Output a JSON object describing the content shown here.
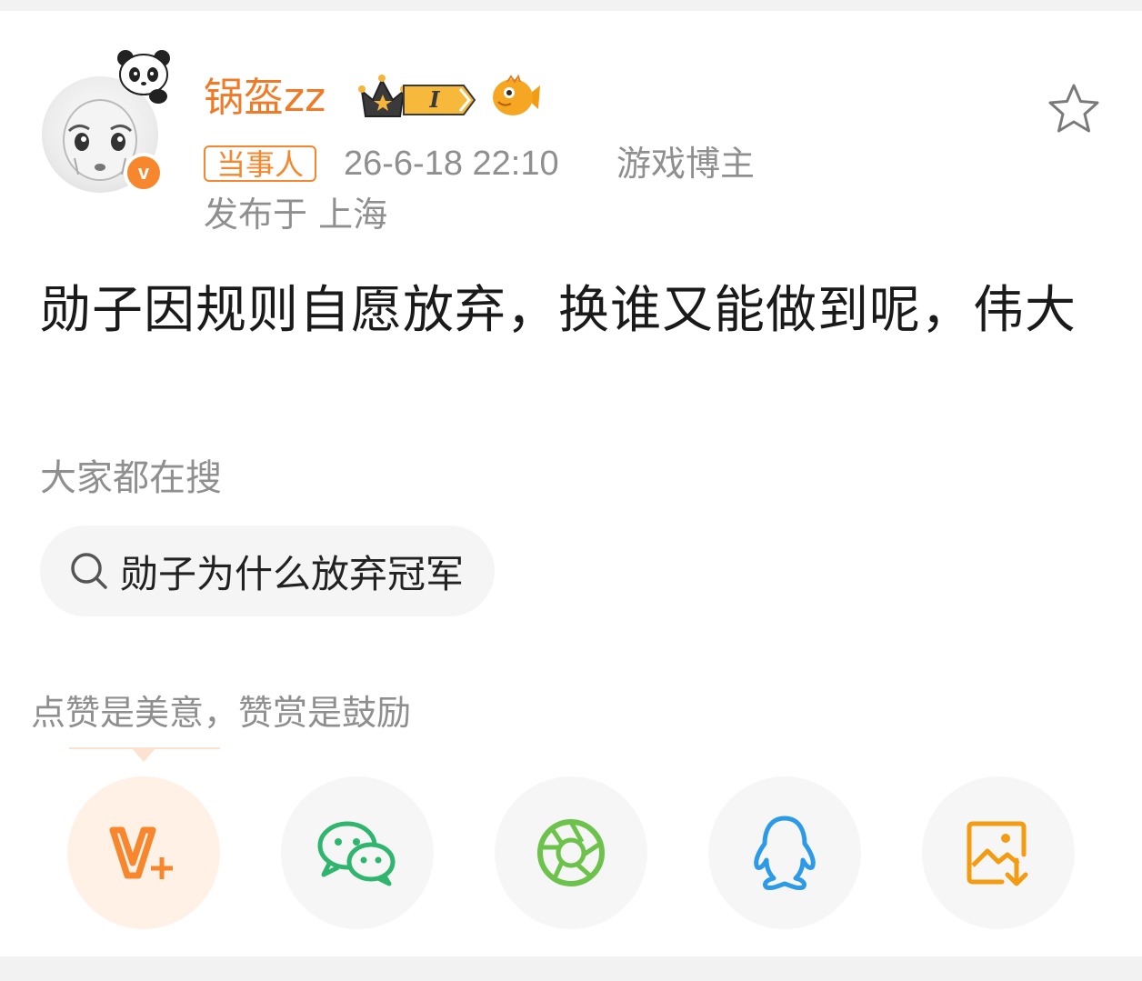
{
  "post": {
    "author": {
      "name": "锅盔zz",
      "verified_mark": "v",
      "level_badge": "I",
      "avatar_icon": "panda-cartoon-avatar"
    },
    "role_tag": "当事人",
    "time": "26-6-18 22:10",
    "author_role": "游戏博主",
    "location": "发布于 上海",
    "content": "勋子因规则自愿放弃，换谁又能做到呢，伟大"
  },
  "search": {
    "heading": "大家都在搜",
    "suggestion": "勋子为什么放弃冠军"
  },
  "reward": {
    "tip": "点赞是美意，赞赏是鼓励"
  },
  "share": {
    "items": [
      {
        "icon": "reward-v-plus-icon",
        "color": "#f7862c"
      },
      {
        "icon": "wechat-icon",
        "color": "#2fb56e"
      },
      {
        "icon": "moments-icon",
        "color": "#6cc24a"
      },
      {
        "icon": "qq-icon",
        "color": "#2d9ae8"
      },
      {
        "icon": "save-image-icon",
        "color": "#f39c12"
      }
    ]
  },
  "colors": {
    "accent": "#f7862c",
    "username": "#f17a26",
    "muted": "#8f8f8f"
  }
}
